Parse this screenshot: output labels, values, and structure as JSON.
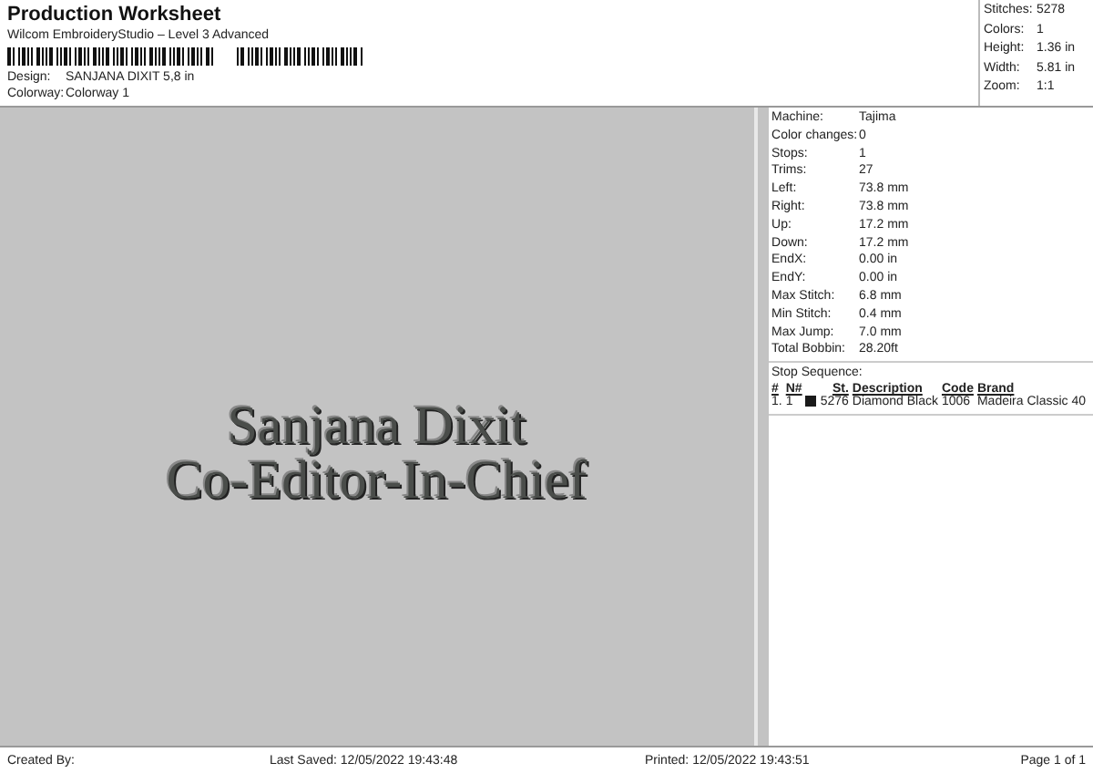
{
  "header": {
    "title": "Production Worksheet",
    "subtitle": "Wilcom EmbroideryStudio – Level 3 Advanced",
    "fields": [
      {
        "label": "Design:",
        "value": "SANJANA DIXIT 5,8 in"
      },
      {
        "label": "Colorway:",
        "value": "Colorway 1"
      }
    ]
  },
  "summary": [
    {
      "label": "Stitches:",
      "value": "5278"
    },
    {
      "label": "Colors:",
      "value": "1"
    },
    {
      "label": "Height:",
      "value": "1.36 in"
    },
    {
      "label": "Width:",
      "value": "5.81 in"
    },
    {
      "label": "Zoom:",
      "value": "1:1"
    }
  ],
  "design_preview": {
    "lines": [
      "Sanjana Dixit",
      "Co-Editor-In-Chief"
    ]
  },
  "details": [
    {
      "label": "Machine:",
      "value": "Tajima"
    },
    {
      "label": "Color changes:",
      "value": "0"
    },
    {
      "label": "Stops:",
      "value": "1"
    },
    {
      "label": "Trims:",
      "value": "27"
    },
    {
      "label": "Left:",
      "value": "73.8 mm"
    },
    {
      "label": "Right:",
      "value": "73.8 mm"
    },
    {
      "label": "Up:",
      "value": "17.2 mm"
    },
    {
      "label": "Down:",
      "value": "17.2 mm"
    },
    {
      "label": "EndX:",
      "value": "0.00 in"
    },
    {
      "label": "EndY:",
      "value": "0.00 in"
    },
    {
      "label": "Max Stitch:",
      "value": "6.8 mm"
    },
    {
      "label": "Min Stitch:",
      "value": "0.4 mm"
    },
    {
      "label": "Max Jump:",
      "value": "7.0 mm"
    },
    {
      "label": "Total Bobbin:",
      "value": "28.20ft"
    }
  ],
  "stop_sequence": {
    "title": "Stop Sequence:",
    "columns": [
      "#",
      "N#",
      "St.",
      "Description",
      "Code",
      "Brand"
    ],
    "rows": [
      {
        "number": "1.",
        "needle": "1",
        "color": "#1a1a1a",
        "stitches": "5276",
        "description": "Diamond Black",
        "code": "1006",
        "brand": "Madeira Classic 40"
      }
    ]
  },
  "footer": {
    "created_by": "Created By:",
    "last_saved": "Last Saved: 12/05/2022 19:43:48",
    "printed": "Printed: 12/05/2022 19:43:51",
    "page": "Page 1 of 1"
  }
}
